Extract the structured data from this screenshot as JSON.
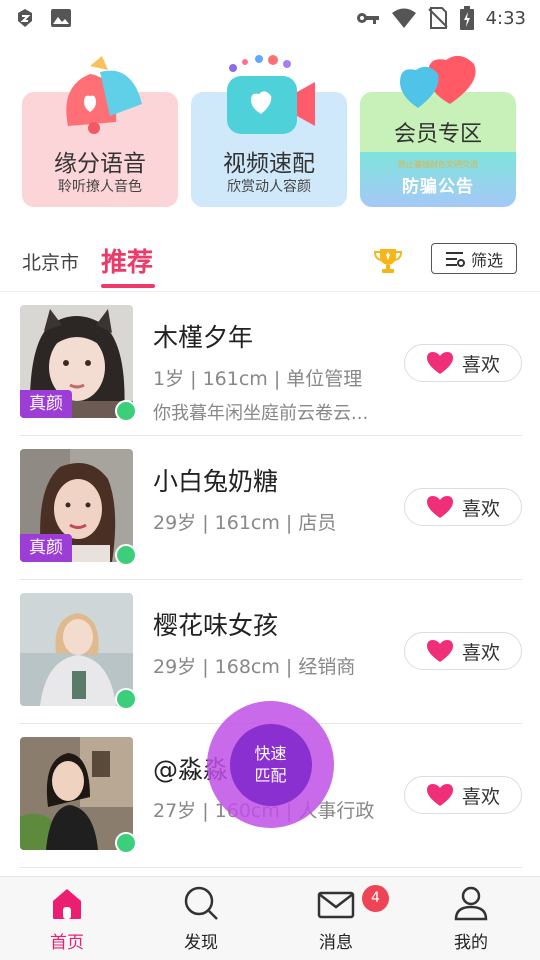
{
  "status_bar": {
    "time": "4:33"
  },
  "banners": [
    {
      "title": "缘分语音",
      "subtitle": "聆听撩人音色"
    },
    {
      "title": "视频速配",
      "subtitle": "欣赏动人容颜"
    },
    {
      "title": "会员专区",
      "line1": "防止骗钱财色文明交流",
      "line2": "防骗公告"
    }
  ],
  "tabs": {
    "city": "北京市",
    "recommend": "推荐",
    "filter_label": "筛选"
  },
  "users": [
    {
      "name": "木槿夕年",
      "info": "1岁 | 161cm | 单位管理",
      "bio": "你我暮年闲坐庭前云卷云...",
      "badge": "真颜",
      "like": "喜欢"
    },
    {
      "name": "小白兔奶糖",
      "info": "29岁 | 161cm | 店员",
      "bio": "",
      "badge": "真颜",
      "like": "喜欢"
    },
    {
      "name": "樱花味女孩",
      "info": "29岁 | 168cm | 经销商",
      "bio": "",
      "badge": "",
      "like": "喜欢"
    },
    {
      "name": "@淼淼",
      "info": "27岁 | 160cm | 人事行政",
      "bio": "",
      "badge": "",
      "like": "喜欢"
    }
  ],
  "fab": {
    "line1": "快速",
    "line2": "匹配"
  },
  "nav": {
    "home": "首页",
    "discover": "发现",
    "messages": "消息",
    "messages_badge": "4",
    "me": "我的"
  },
  "colors": {
    "accent": "#ec3a6a",
    "online": "#3ccf7b",
    "badge": "#9c3ed6",
    "fab": "#8a2fd0"
  }
}
